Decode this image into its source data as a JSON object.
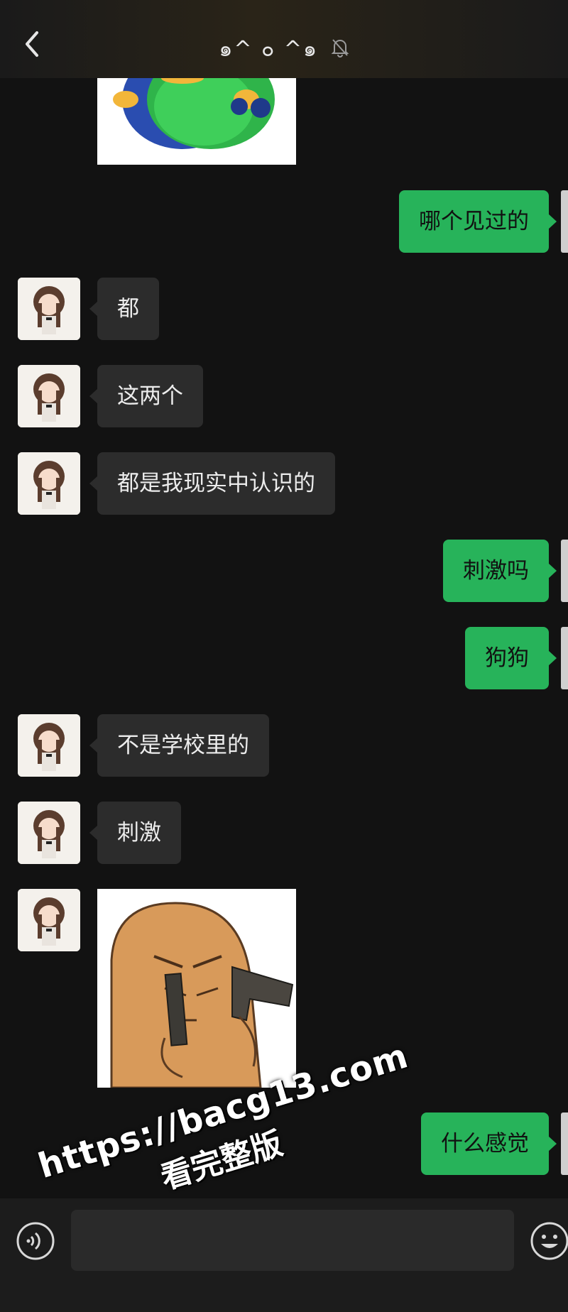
{
  "header": {
    "title": "๑^ ๐ ^๑",
    "back_icon": "chevron-left-icon",
    "muted_icon": "bell-off-icon"
  },
  "messages": [
    {
      "side": "in",
      "type": "sticker",
      "desc": "green-blob-sticker"
    },
    {
      "side": "out",
      "type": "text",
      "text": "哪个见过的"
    },
    {
      "side": "in",
      "type": "text",
      "text": "都"
    },
    {
      "side": "in",
      "type": "text",
      "text": "这两个"
    },
    {
      "side": "in",
      "type": "text",
      "text": "都是我现实中认识的"
    },
    {
      "side": "out",
      "type": "text",
      "text": "刺激吗"
    },
    {
      "side": "out",
      "type": "text",
      "text": "狗狗"
    },
    {
      "side": "in",
      "type": "text",
      "text": "不是学校里的"
    },
    {
      "side": "in",
      "type": "text",
      "text": "刺激"
    },
    {
      "side": "in",
      "type": "sticker",
      "desc": "guns-face-sticker"
    },
    {
      "side": "out",
      "type": "text",
      "text": "什么感觉"
    }
  ],
  "input": {
    "placeholder": "",
    "voice_icon": "voice-icon",
    "emoji_icon": "emoji-icon"
  },
  "watermark": {
    "url": "https://bacg13.com",
    "subtitle": "看完整版"
  },
  "colors": {
    "background": "#121212",
    "bubble_in": "#2c2c2c",
    "bubble_out": "#27b35a"
  }
}
